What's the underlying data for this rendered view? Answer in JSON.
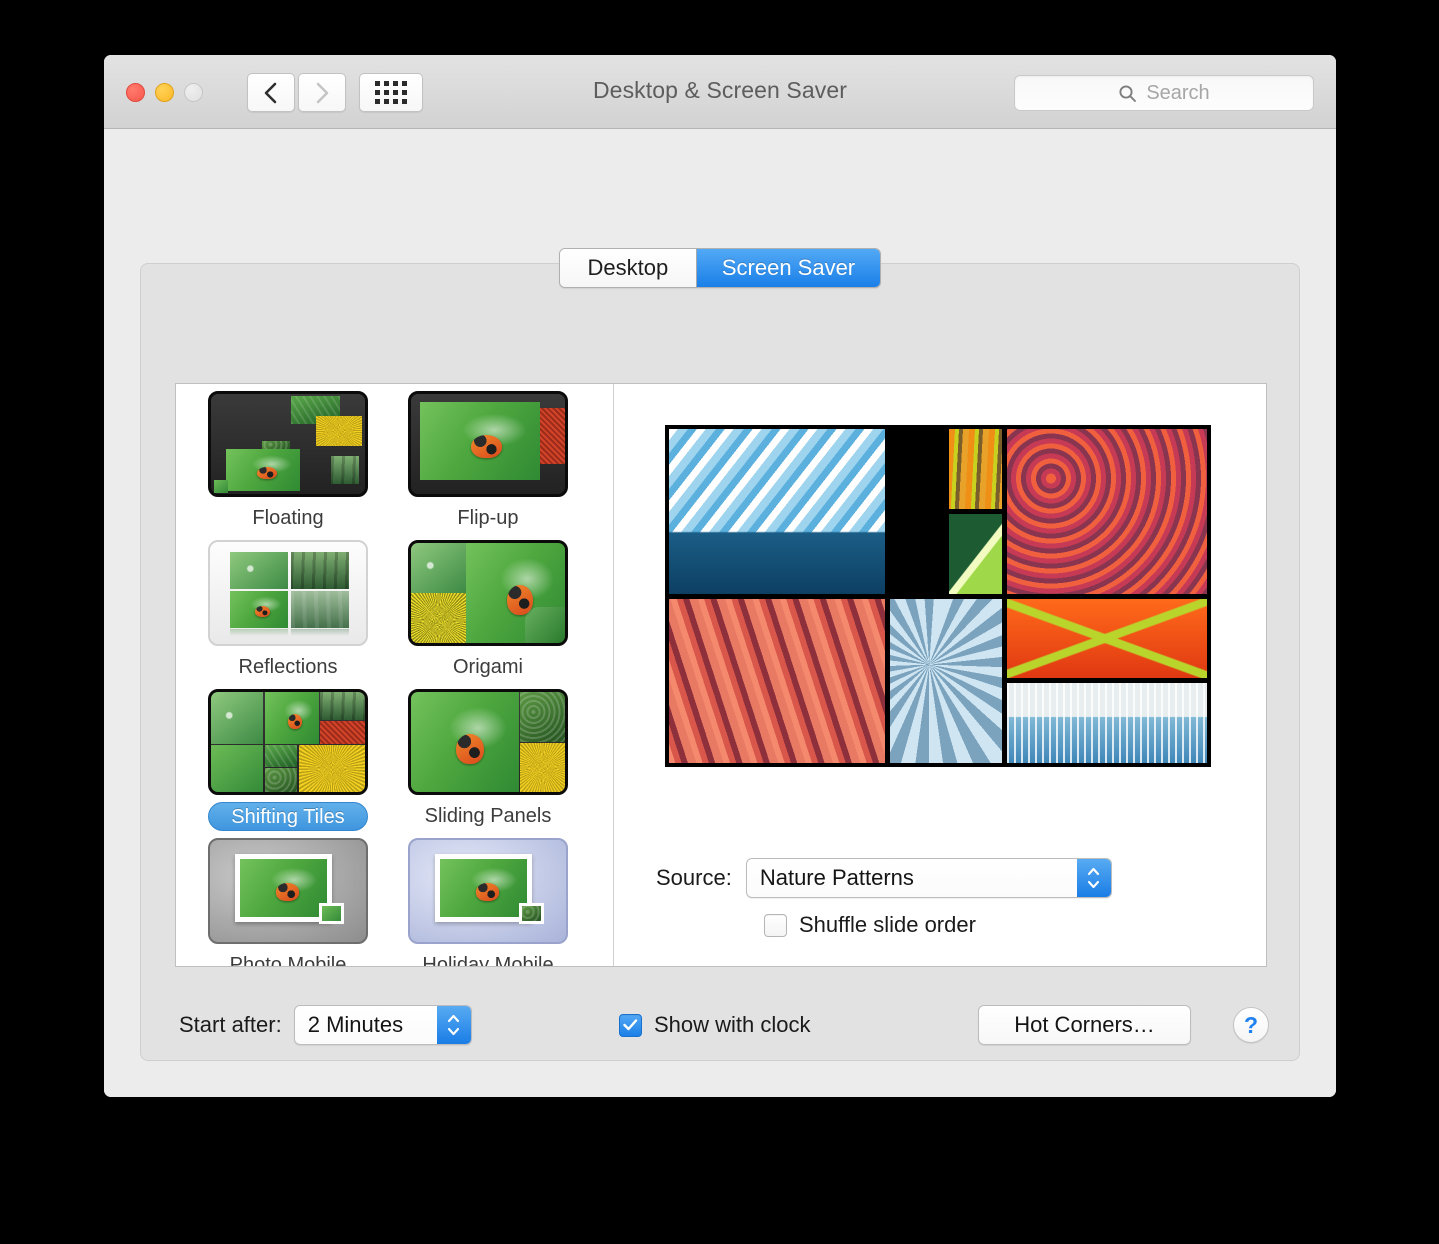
{
  "window": {
    "title": "Desktop & Screen Saver",
    "traffic_lights": [
      "close-button",
      "minimize-button",
      "zoom-button"
    ],
    "nav": {
      "back": "back-icon",
      "forward": "forward-icon",
      "show_all": "grid-icon"
    },
    "search": {
      "placeholder": "Search",
      "icon": "search-icon"
    }
  },
  "tabs": [
    {
      "label": "Desktop",
      "active": false
    },
    {
      "label": "Screen Saver",
      "active": true
    }
  ],
  "screensavers": [
    {
      "label": "Floating",
      "selected": false,
      "style": "dark"
    },
    {
      "label": "Flip-up",
      "selected": false,
      "style": "dark"
    },
    {
      "label": "Reflections",
      "selected": false,
      "style": "light"
    },
    {
      "label": "Origami",
      "selected": false,
      "style": "dark"
    },
    {
      "label": "Shifting Tiles",
      "selected": true,
      "style": "dark"
    },
    {
      "label": "Sliding Panels",
      "selected": false,
      "style": "dark"
    },
    {
      "label": "Photo Mobile",
      "selected": false,
      "style": "gray"
    },
    {
      "label": "Holiday Mobile",
      "selected": false,
      "style": "blue"
    },
    {
      "label": "",
      "selected": false,
      "style": "cream"
    },
    {
      "label": "",
      "selected": false,
      "style": "dark"
    }
  ],
  "preview": {
    "tiles": [
      "glacier-ice",
      "eucalyptus-bark",
      "autumn-forest",
      "green-leaf",
      "red-sandstone",
      "frost-crystals",
      "orange-leaf",
      "winter-birch"
    ]
  },
  "source": {
    "label": "Source:",
    "value": "Nature Patterns",
    "stepper": "stepper-icon"
  },
  "shuffle": {
    "label": "Shuffle slide order",
    "checked": false
  },
  "start_after": {
    "label": "Start after:",
    "value": "2 Minutes"
  },
  "show_clock": {
    "label": "Show with clock",
    "checked": true
  },
  "hot_corners": {
    "label": "Hot Corners…"
  },
  "help": {
    "label": "?"
  },
  "colors": {
    "accent_blue": "#1c7fe7",
    "selection_blue": "#3f95de",
    "close_red": "#f9564a",
    "min_yellow": "#fcb827",
    "zoom_gray": "#e0e0e0",
    "window_bg": "#ececec",
    "panel_bg": "#e2e2e2"
  }
}
